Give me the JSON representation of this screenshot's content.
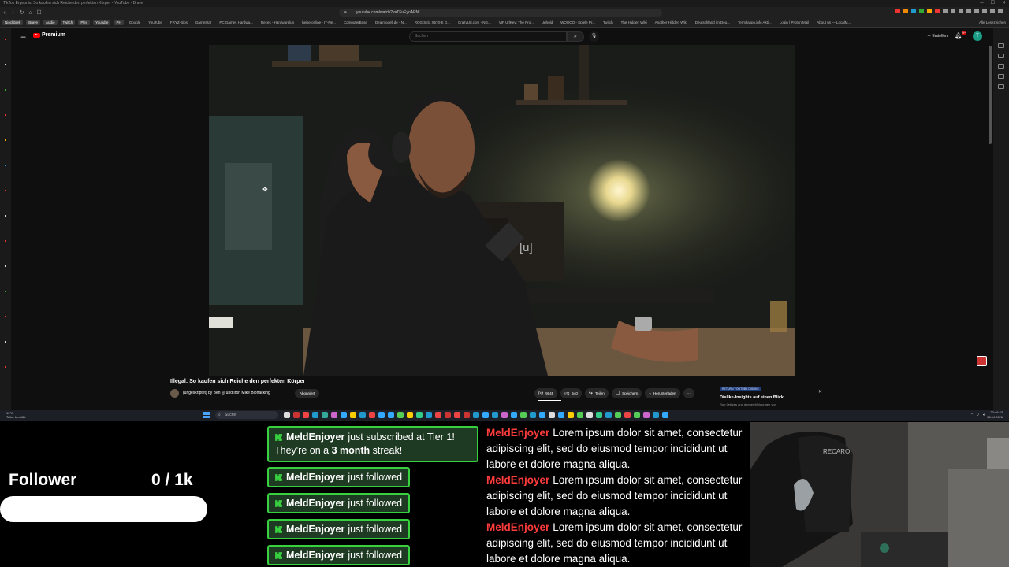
{
  "browser": {
    "window_title": "TikTok Ergebnis: So kaufen sich Reiche den perfekten Körper - YouTube - Brave",
    "url": "youtube.com/watch?v=TFuEyoAPNI",
    "bookmarks": [
      {
        "label": "Niochbrek",
        "tag": true
      },
      {
        "label": "Brave",
        "tag": true
      },
      {
        "label": "Audio",
        "tag": true
      },
      {
        "label": "Twitch",
        "tag": true
      },
      {
        "label": "Plex",
        "tag": true
      },
      {
        "label": "Youtube",
        "tag": true
      },
      {
        "label": "PH",
        "tag": true
      },
      {
        "label": "Google",
        "tag": false
      },
      {
        "label": "YouTube",
        "tag": false
      },
      {
        "label": "FRYZ-Bios",
        "tag": false
      },
      {
        "label": "GameStar",
        "tag": false
      },
      {
        "label": "PC Games Hardwa...",
        "tag": false
      },
      {
        "label": "Reces - Hardwarelun",
        "tag": false
      },
      {
        "label": "heise online - IT-Ne...",
        "tag": false
      },
      {
        "label": "ComputerBase",
        "tag": false
      },
      {
        "label": "Dealmodell.de - N...",
        "tag": false
      },
      {
        "label": "ROG Strix X570-E G...",
        "tag": false
      },
      {
        "label": "CrazyUrl.com - NG...",
        "tag": false
      },
      {
        "label": "VIP UrlKey: The Pro...",
        "tag": false
      },
      {
        "label": "Uphold",
        "tag": false
      },
      {
        "label": "WOOCO - Spiele Pr...",
        "tag": false
      },
      {
        "label": "Twitch",
        "tag": false
      },
      {
        "label": "The Hidden Wiki",
        "tag": false
      },
      {
        "label": "Another Hidden Wiki",
        "tag": false
      },
      {
        "label": "Deutschland im Deu...",
        "tag": false
      },
      {
        "label": "Termkaspo.info Akti...",
        "tag": false
      },
      {
        "label": "Login | Proton Mail",
        "tag": false
      },
      {
        "label": "About us — LocalM...",
        "tag": false
      }
    ],
    "bookmarks_right": "Alle Lesezeichen"
  },
  "youtube": {
    "logo_text": "Premium",
    "search_placeholder": "Suchen",
    "create_label": "Erstellen",
    "notification_count": "9+",
    "avatar_letter": "T",
    "video_title": "Illegal: So kaufen sich Reiche den perfekten Körper",
    "channel_name": "(ungeskriptet) by Ben ◎ und Iron Mike Biohacking",
    "subscribed_label": "Abonniert",
    "like_count": "9045",
    "dislike_count": "540",
    "share_label": "Teilen",
    "save_label": "Speichern",
    "download_label": "Herunterladen",
    "more_label": "···",
    "rudl_tag": "RETURN YOUTUBE DISLIKE",
    "rudl_title": "Dislike-Insights auf einen Blick",
    "rudl_sub": "Rob Ortiizes and deeper Meldungen von"
  },
  "taskbar": {
    "weather_temp": "10°C",
    "weather_desc": "Teilw. bewölkt",
    "search_placeholder": "Suche",
    "time": "20:46:43",
    "date": "18.04.2026"
  },
  "overlay": {
    "follower_label": "Follower",
    "follower_count": "0 / 1k",
    "follower_progress": 0,
    "alerts": {
      "sub_user": "MeldEnjoyer",
      "sub_text": "just subscribed at Tier 1!",
      "sub_line2_pre": "They're on a ",
      "sub_streak": "3 month",
      "sub_line2_post": " streak!",
      "follows": [
        {
          "user": "MeldEnjoyer",
          "text": "just followed"
        },
        {
          "user": "MeldEnjoyer",
          "text": "just followed"
        },
        {
          "user": "MeldEnjoyer",
          "text": "just followed"
        },
        {
          "user": "MeldEnjoyer",
          "text": "just followed"
        }
      ]
    },
    "chat": [
      {
        "user": "MeldEnjoyer",
        "text": "Lorem ipsum dolor sit amet, consectetur adipiscing elit, sed do eiusmod tempor incididunt ut labore et dolore magna aliqua."
      },
      {
        "user": "MeldEnjoyer",
        "text": "Lorem ipsum dolor sit amet, consectetur adipiscing elit, sed do eiusmod tempor incididunt ut labore et dolore magna aliqua."
      },
      {
        "user": "MeldEnjoyer",
        "text": "Lorem ipsum dolor sit amet, consectetur adipiscing elit, sed do eiusmod tempor incididunt ut labore et dolore magna aliqua."
      }
    ]
  },
  "colors": {
    "alert_border": "#37d03f",
    "alert_bg": "#1f3a22",
    "chat_user": "#ff3b3b",
    "yt_red": "#ff0000"
  }
}
